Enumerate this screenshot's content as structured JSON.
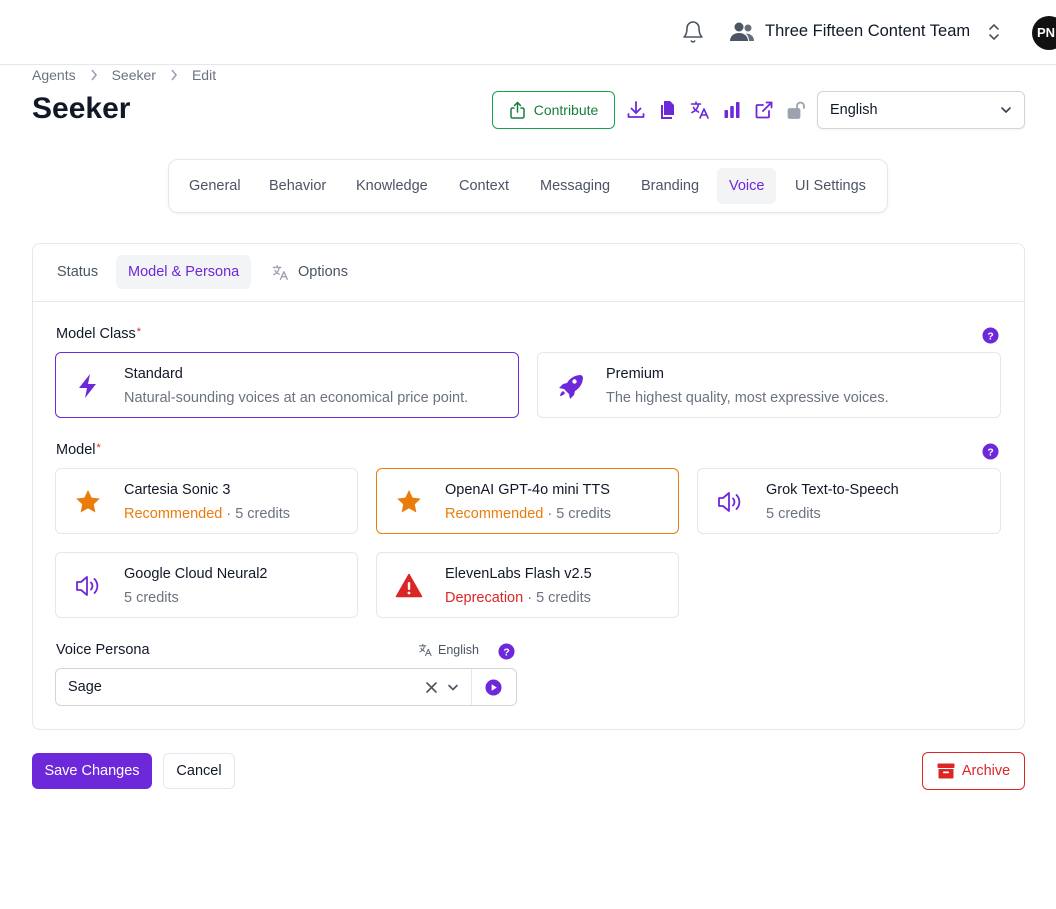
{
  "topbar": {
    "team_name": "Three Fifteen Content Team",
    "avatar_initials": "PN",
    "icons": [
      "bell-icon",
      "users-icon",
      "chevron-up-down-icon"
    ]
  },
  "breadcrumb": [
    "Agents",
    "Seeker",
    "Edit"
  ],
  "page": {
    "title": "Seeker",
    "contribute_label": "Contribute",
    "language_selected": "English",
    "action_icons": [
      "download-icon",
      "copy-icon",
      "translate-icon",
      "analytics-icon",
      "external-link-icon",
      "unlock-icon"
    ]
  },
  "main_tabs": [
    "General",
    "Behavior",
    "Knowledge",
    "Context",
    "Messaging",
    "Branding",
    "Voice",
    "UI Settings"
  ],
  "main_tab_active": "Voice",
  "sub_tabs": [
    "Status",
    "Model & Persona",
    "Options"
  ],
  "sub_tab_active": "Model & Persona",
  "model_class": {
    "label": "Model Class",
    "required_mark": "*",
    "options": [
      {
        "title": "Standard",
        "description": "Natural-sounding voices at an economical price point.",
        "icon": "bolt-icon",
        "selected": true
      },
      {
        "title": "Premium",
        "description": "The highest quality, most expressive voices.",
        "icon": "rocket-icon",
        "selected": false
      }
    ]
  },
  "model": {
    "label": "Model",
    "required_mark": "*",
    "options": [
      {
        "title": "Cartesia Sonic 3",
        "tag": "Recommended",
        "credits": " · 5 credits",
        "icon": "star-icon",
        "selected": false
      },
      {
        "title": "OpenAI GPT-4o mini TTS",
        "tag": "Recommended",
        "credits": " · 5 credits",
        "icon": "star-icon",
        "selected": true
      },
      {
        "title": "Grok Text-to-Speech",
        "tag": "",
        "credits": "5 credits",
        "icon": "speaker-icon",
        "selected": false
      },
      {
        "title": "Google Cloud Neural2",
        "tag": "",
        "credits": "5 credits",
        "icon": "speaker-icon",
        "selected": false
      },
      {
        "title": "ElevenLabs Flash v2.5",
        "tag": "Deprecation",
        "credits": " · 5 credits",
        "icon": "warning-icon",
        "selected": false
      }
    ]
  },
  "voice_persona": {
    "label": "Voice Persona",
    "language": "English",
    "value": "Sage"
  },
  "footer": {
    "save_label": "Save Changes",
    "cancel_label": "Cancel",
    "archive_label": "Archive"
  },
  "colors": {
    "accent": "#6d28d9",
    "recommended": "#ea7c0c",
    "danger": "#dc2626",
    "success": "#16a34a"
  }
}
